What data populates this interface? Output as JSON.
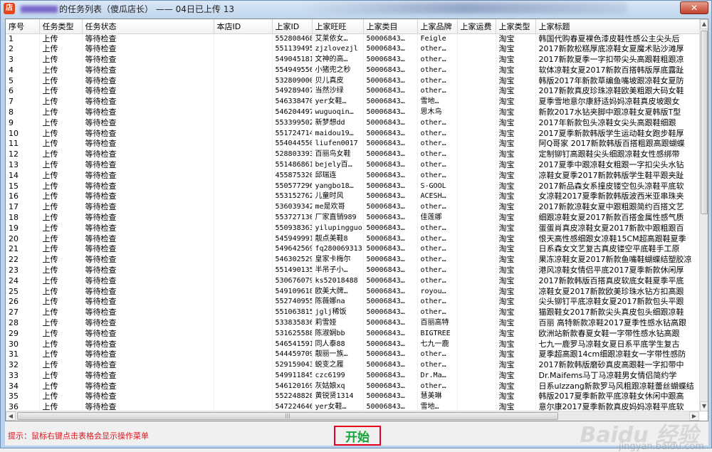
{
  "window": {
    "icon_label": "店",
    "title_suffix": "的任务列表（傻瓜店长） —— 04日已上传 13",
    "close_label": "✕"
  },
  "table": {
    "columns": [
      "序号",
      "任务类型",
      "任务状态",
      "本店ID",
      "上家ID",
      "上家旺旺",
      "上家类目",
      "上家品牌",
      "上家运费",
      "上家类型",
      "上家标题"
    ],
    "rows": [
      [
        "1",
        "上传",
        "等待检查",
        "",
        "552808468766",
        "艾莱依女…",
        "50006843…",
        "Feigle",
        "",
        "淘宝",
        "韩国代购春夏裸色漆皮鞋性感公主尖头后"
      ],
      [
        "2",
        "上传",
        "等待检查",
        "",
        "551139495873",
        "zjzlovezjl",
        "50006843…",
        "other…",
        "",
        "淘宝",
        "2017新款松糕厚底凉鞋女夏魔术贴沙滩厚"
      ],
      [
        "3",
        "上传",
        "等待检查",
        "",
        "549045181133",
        "文神的高…",
        "50006843…",
        "other…",
        "",
        "淘宝",
        "2017新款夏季一字扣带尖头高跟鞋粗跟凉"
      ],
      [
        "4",
        "上传",
        "等待检查",
        "",
        "554949556068",
        "小猪兜之秒",
        "50006843…",
        "other…",
        "",
        "淘宝",
        "软体凉鞋女夏2017新款百搭韩版厚底露趾"
      ],
      [
        "5",
        "上传",
        "等待检查",
        "",
        "532809000124",
        "贝儿真皮",
        "50006843…",
        "other…",
        "",
        "淘宝",
        "韩版2017年新款草编鱼嘴坡跟凉鞋女夏防"
      ],
      [
        "6",
        "上传",
        "等待检查",
        "",
        "549289407756",
        "当然沙绿",
        "50006843…",
        "other…",
        "",
        "淘宝",
        "2017新款真皮珍珠凉鞋欧美粗跟大码女鞋"
      ],
      [
        "7",
        "上传",
        "等待检查",
        "",
        "546338470356",
        "yer女鞋…",
        "50006843…",
        "雪地…",
        "",
        "淘宝",
        "夏季雪地意尔康舒适妈妈凉鞋真皮坡跟女"
      ],
      [
        "8",
        "上传",
        "等待检查",
        "",
        "546204497715",
        "wuguoqin…",
        "50006843…",
        "思木鸟",
        "",
        "淘宝",
        "新款2017水钻夹脚中跟凉鞋女夏韩版T型"
      ],
      [
        "9",
        "上传",
        "等待检查",
        "",
        "553399502137",
        "新梦想dd",
        "50006843…",
        "other…",
        "",
        "淘宝",
        "2017年新款包头凉鞋女尖头高跟鞋细跟"
      ],
      [
        "10",
        "上传",
        "等待检查",
        "",
        "551724714912",
        "maidou19…",
        "50006843…",
        "other…",
        "",
        "淘宝",
        "2017夏季新款韩版学生运动鞋女跑步鞋厚"
      ],
      [
        "11",
        "上传",
        "等待检查",
        "",
        "554044550334",
        "liufen0017",
        "50006843…",
        "other…",
        "",
        "淘宝",
        "阿Q哥家 2017新款韩版百搭粗跟高跟蝴蝶"
      ],
      [
        "12",
        "上传",
        "等待检查",
        "",
        "528803393638",
        "百丽鸟女鞋",
        "50006843…",
        "other…",
        "",
        "淘宝",
        "定制铆钉高跟鞋尖头细跟凉鞋女性感绑带"
      ],
      [
        "13",
        "上传",
        "等待检查",
        "",
        "551486861880",
        "bejely百…",
        "50006843…",
        "other…",
        "",
        "淘宝",
        "2017夏季中跟凉鞋女粗跟一字扣尖头水钻"
      ],
      [
        "14",
        "上传",
        "等待检查",
        "",
        "45587532096",
        "邱瑞连",
        "50006843…",
        "other…",
        "",
        "淘宝",
        "凉鞋女夏季2017新款韩版学生鞋平跟夹趾"
      ],
      [
        "15",
        "上传",
        "等待检查",
        "",
        "550577296683",
        "yangbo18…",
        "50006843…",
        "S-GOOL",
        "",
        "淘宝",
        "2017新品森女系撞皮镂空包头凉鞋平底软"
      ],
      [
        "16",
        "上传",
        "等待检查",
        "",
        "553152762420",
        "儿童时风",
        "50006843…",
        "ACESH…",
        "",
        "淘宝",
        "女凉鞋2017夏季新款韩版波西米亚串珠夹"
      ],
      [
        "17",
        "上传",
        "等待检查",
        "",
        "536039342438",
        "me是欢哥",
        "50006843…",
        "other…",
        "",
        "淘宝",
        "2017新款凉鞋女夏中跟粗跟简约百搭文艺"
      ],
      [
        "18",
        "上传",
        "等待检查",
        "",
        "553727130030",
        "厂家直销989",
        "50006843…",
        "佳莲娜",
        "",
        "淘宝",
        "细跟凉鞋女夏2017新款百搭金属性感气质"
      ],
      [
        "19",
        "上传",
        "等待检查",
        "",
        "550938363834",
        "yilupingguo",
        "50006843…",
        "other…",
        "",
        "淘宝",
        "蛋蛋肖真皮凉鞋女夏2017新款中跟粗跟百"
      ],
      [
        "20",
        "上传",
        "等待检查",
        "",
        "545949991660",
        "靓点美鞋8",
        "50006843…",
        "other…",
        "",
        "淘宝",
        "恨天高性感细跟女凉鞋15CM超高跟鞋夏季"
      ],
      [
        "21",
        "上传",
        "等待检查",
        "",
        "549642569618",
        "fq280069313",
        "50006843…",
        "other…",
        "",
        "淘宝",
        "日系森女文艺复古真皮镂空平底鞋手工原"
      ],
      [
        "22",
        "上传",
        "等待检查",
        "",
        "546302529170",
        "皇家卡梅尔",
        "50006843…",
        "other…",
        "",
        "淘宝",
        "果冻凉鞋女夏2017新款鱼嘴鞋蝴蝶结塑胶凉"
      ],
      [
        "23",
        "上传",
        "等待检查",
        "",
        "551490135439",
        "半吊子小…",
        "50006843…",
        "other…",
        "",
        "淘宝",
        "港风凉鞋女情侣平底2017夏季新款休闲厚"
      ],
      [
        "24",
        "上传",
        "等待检查",
        "",
        "530676079087",
        "ks52018488",
        "50006843…",
        "other…",
        "",
        "淘宝",
        "2017新款韩版百搭真皮软底女鞋夏季平底"
      ],
      [
        "25",
        "上传",
        "等待检查",
        "",
        "549109618992",
        "欧美大牌…",
        "50006843…",
        "royou…",
        "",
        "淘宝",
        "凉鞋女夏2017新款欧美珍珠水钻方扣高跟"
      ],
      [
        "26",
        "上传",
        "等待检查",
        "",
        "552740955762",
        "陈薇娜na",
        "50006843…",
        "other…",
        "",
        "淘宝",
        "尖头铆钉平底凉鞋女夏2017新款包头平跟"
      ],
      [
        "27",
        "上传",
        "等待检查",
        "",
        "551063815291",
        "jglj稀饭",
        "50006843…",
        "other…",
        "",
        "淘宝",
        "猫跟鞋女2017新款尖头真皮包头细跟凉鞋"
      ],
      [
        "28",
        "上传",
        "等待检查",
        "",
        "533835836785",
        "莉雪娅",
        "50006843…",
        "百丽高特",
        "",
        "淘宝",
        "百丽 高特新款凉鞋2017夏季性感水钻高跟"
      ],
      [
        "29",
        "上传",
        "等待检查",
        "",
        "531625588272",
        "陈淑娴bb",
        "50006843…",
        "BIGTREE",
        "",
        "淘宝",
        "欧洲站新款春夏女鞋一字带性感水钻高跟"
      ],
      [
        "30",
        "上传",
        "等待检查",
        "",
        "546541591043",
        "同人泰88",
        "50006843…",
        "七九一鹿",
        "",
        "淘宝",
        "七九一鹿罗马凉鞋女夏日系平底学生复古"
      ],
      [
        "31",
        "上传",
        "等待检查",
        "",
        "544459709749",
        "靓丽一族…",
        "50006843…",
        "other…",
        "",
        "淘宝",
        "夏季超高跟14cm细跟凉鞋女一字带性感防"
      ],
      [
        "32",
        "上传",
        "等待检查",
        "",
        "529159043993",
        "蜕变之履",
        "50006843…",
        "other…",
        "",
        "淘宝",
        "2017新款韩版磨砂真皮高跟鞋一字扣带中"
      ],
      [
        "33",
        "上传",
        "等待检查",
        "",
        "549911845617",
        "czc6199",
        "50006843…",
        "Dr.Ma…",
        "",
        "淘宝",
        "Dr.Maifems马丁马凉鞋男女情侣简约学"
      ],
      [
        "34",
        "上传",
        "等待检查",
        "",
        "546120169222",
        "灰姑娘xq",
        "50006843…",
        "other…",
        "",
        "淘宝",
        "日系ulzzang新款罗马风粗跟凉鞋蕾丝蝴蝶结"
      ],
      [
        "35",
        "上传",
        "等待检查",
        "",
        "552248828961",
        "黄锐贤1314",
        "50006843…",
        "慧美琳",
        "",
        "淘宝",
        "韩版2017夏季新款平底凉鞋女休闲中跟高"
      ],
      [
        "36",
        "上传",
        "等待检查",
        "",
        "547224646737",
        "yer女鞋…",
        "50006843…",
        "雪地…",
        "",
        "淘宝",
        "意尔康2017夏季新款真皮妈妈凉鞋平底软"
      ]
    ]
  },
  "scrollbar": {
    "h_thumb_grip": "|||"
  },
  "footer": {
    "hint": "提示：鼠标右键点击表格会显示操作菜单",
    "start_label": "开始"
  },
  "watermark": {
    "text": "jingyan.baidu.com",
    "logo": "Baidu 经验"
  }
}
